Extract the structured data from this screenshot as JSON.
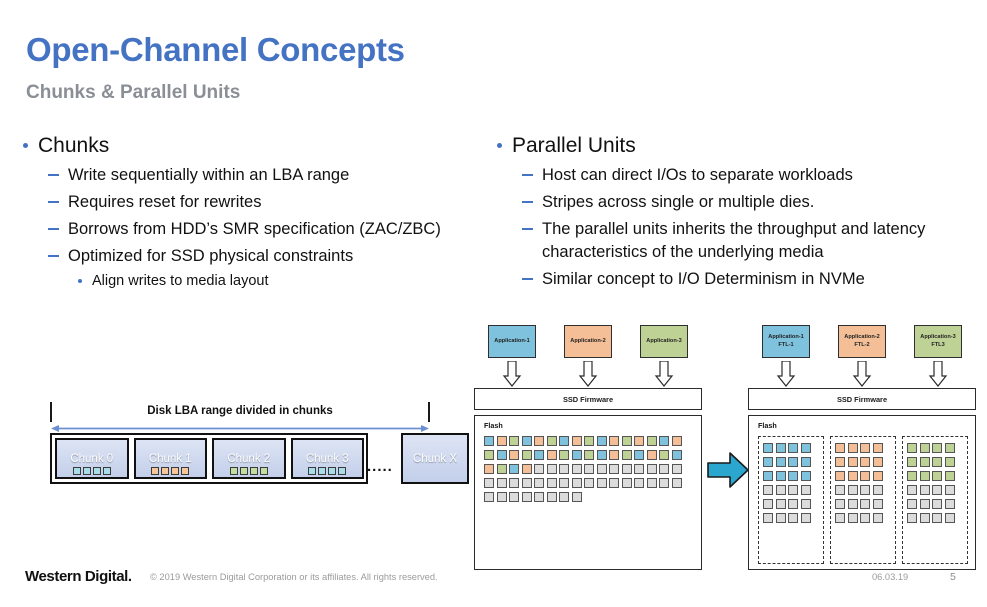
{
  "slide": {
    "title": "Open-Channel Concepts",
    "subtitle": "Chunks & Parallel Units",
    "title_color": "#4473C4",
    "subtitle_color": "#8A8F96",
    "accent_color": "#4473C4"
  },
  "columns": {
    "left": {
      "heading": "Chunks",
      "items": [
        "Write sequentially within an LBA range",
        "Requires reset for rewrites",
        "Borrows from HDD’s SMR specification (ZAC/ZBC)",
        "Optimized for SSD physical constraints"
      ],
      "subitem": "Align writes to media layout"
    },
    "right": {
      "heading": "Parallel Units",
      "items": [
        "Host can direct I/Os to separate workloads",
        "Stripes across single or multiple dies.",
        "The parallel units inherits the throughput and latency characteristics of the underlying media",
        "Similar concept to I/O Determinism in NVMe"
      ]
    }
  },
  "chunk_diagram": {
    "range_label": "Disk LBA range divided in chunks",
    "ellipsis": ".....",
    "chunks": [
      {
        "label": "Chunk 0",
        "square_color": "#A8DCE8"
      },
      {
        "label": "Chunk 1",
        "square_color": "#F7C59A"
      },
      {
        "label": "Chunk 2",
        "square_color": "#C3DCA0"
      },
      {
        "label": "Chunk 3",
        "square_color": "#A8DCE8"
      }
    ],
    "squares_per_chunk": 4,
    "last_chunk": {
      "label": "Chunk X"
    }
  },
  "arch_left": {
    "apps": [
      {
        "line1": "Application-1",
        "line2": "",
        "color": "#7FC2DE"
      },
      {
        "line1": "Application-2",
        "line2": "",
        "color": "#F4BE97"
      },
      {
        "line1": "Application-3",
        "line2": "",
        "color": "#BFD295"
      }
    ],
    "firmware_label": "SSD Firmware",
    "flash_label": "Flash",
    "grid": {
      "cols": 12,
      "rows": 6,
      "colored_rows": 3
    },
    "cell_colors": [
      "#7FC2DE",
      "#F4BE97",
      "#BFD295"
    ],
    "empty_color": "#DCDCDC"
  },
  "arch_right": {
    "apps": [
      {
        "line1": "Application-1",
        "line2": "FTL-1",
        "color": "#7FC2DE"
      },
      {
        "line1": "Application-2",
        "line2": "FTL-2",
        "color": "#F4BE97"
      },
      {
        "line1": "Application-3",
        "line2": "FTL3",
        "color": "#BFD295"
      }
    ],
    "firmware_label": "SSD Firmware",
    "flash_label": "Flash",
    "groups": [
      {
        "color": "#7FC2DE"
      },
      {
        "color": "#F4BE97"
      },
      {
        "color": "#BFD295"
      }
    ],
    "group_grid": {
      "cols": 4,
      "rows": 6,
      "colored_rows": 3
    },
    "empty_color": "#DCDCDC",
    "transition_arrow_color": "#2BA6CE"
  },
  "footer": {
    "logo": "Western Digital.",
    "copyright": "© 2019 Western Digital Corporation or its affiliates. All rights reserved.",
    "date": "06.03.19",
    "page_number": "5"
  }
}
